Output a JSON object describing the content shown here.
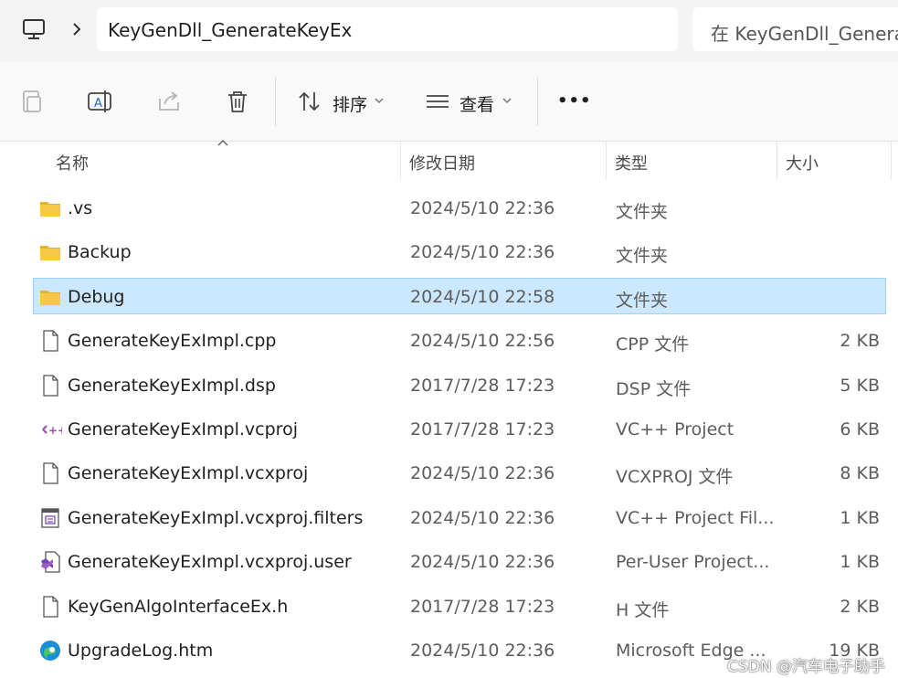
{
  "address": {
    "path": "KeyGenDll_GenerateKeyEx",
    "search_placeholder": "在 KeyGenDll_GenerateKeyEx 中搜索"
  },
  "toolbar": {
    "sort_label": "排序",
    "view_label": "查看",
    "more_label": "•••"
  },
  "columns": {
    "name": "名称",
    "date": "修改日期",
    "type": "类型",
    "size": "大小"
  },
  "files": [
    {
      "name": ".vs",
      "date": "2024/5/10 22:36",
      "type": "文件夹",
      "size": "",
      "icon": "folder-icon"
    },
    {
      "name": "Backup",
      "date": "2024/5/10 22:36",
      "type": "文件夹",
      "size": "",
      "icon": "folder-icon"
    },
    {
      "name": "Debug",
      "date": "2024/5/10 22:58",
      "type": "文件夹",
      "size": "",
      "icon": "folder-icon",
      "selected": true
    },
    {
      "name": "GenerateKeyExImpl.cpp",
      "date": "2024/5/10 22:56",
      "type": "CPP 文件",
      "size": "2 KB",
      "icon": "document-icon"
    },
    {
      "name": "GenerateKeyExImpl.dsp",
      "date": "2017/7/28 17:23",
      "type": "DSP 文件",
      "size": "5 KB",
      "icon": "document-icon"
    },
    {
      "name": "GenerateKeyExImpl.vcproj",
      "date": "2017/7/28 17:23",
      "type": "VC++ Project",
      "size": "6 KB",
      "icon": "vc-project-icon"
    },
    {
      "name": "GenerateKeyExImpl.vcxproj",
      "date": "2024/5/10 22:36",
      "type": "VCXPROJ 文件",
      "size": "8 KB",
      "icon": "document-icon"
    },
    {
      "name": "GenerateKeyExImpl.vcxproj.filters",
      "date": "2024/5/10 22:36",
      "type": "VC++ Project Fil...",
      "size": "1 KB",
      "icon": "filters-icon"
    },
    {
      "name": "GenerateKeyExImpl.vcxproj.user",
      "date": "2024/5/10 22:36",
      "type": "Per-User Project...",
      "size": "1 KB",
      "icon": "visual-studio-icon"
    },
    {
      "name": "KeyGenAlgoInterfaceEx.h",
      "date": "2017/7/28 17:23",
      "type": "H 文件",
      "size": "2 KB",
      "icon": "document-icon"
    },
    {
      "name": "UpgradeLog.htm",
      "date": "2024/5/10 22:36",
      "type": "Microsoft Edge ...",
      "size": "19 KB",
      "icon": "edge-icon"
    }
  ],
  "watermark": "CSDN @汽车电子助手",
  "colors": {
    "selection": "#cce8ff",
    "selection_border": "#99d1ff",
    "folder": "#f7c844"
  }
}
